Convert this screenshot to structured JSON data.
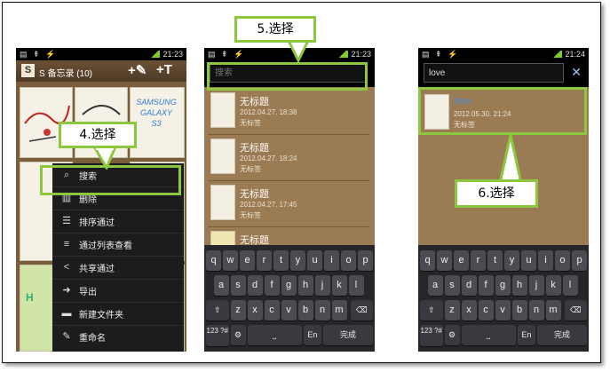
{
  "phone1": {
    "status_time": "21:23",
    "app_title": "S 备忘录 (10)",
    "app_icon": "S",
    "card_text": "SAMSUNG GALAXY S3",
    "menu": [
      {
        "label": "搜索",
        "icon": "search-icon"
      },
      {
        "label": "删除",
        "icon": "delete-icon"
      },
      {
        "label": "排序通过",
        "icon": "sort-icon"
      },
      {
        "label": "通过列表查看",
        "icon": "list-view-icon"
      },
      {
        "label": "共享通过",
        "icon": "share-icon"
      },
      {
        "label": "导出",
        "icon": "export-icon"
      },
      {
        "label": "新建文件夹",
        "icon": "new-folder-icon"
      },
      {
        "label": "重命名",
        "icon": "rename-icon"
      }
    ]
  },
  "phone2": {
    "status_time": "21:23",
    "search_placeholder": "搜索",
    "notes": [
      {
        "title": "无标题",
        "date": "2012.04.27. 18:38",
        "sub": "无标签"
      },
      {
        "title": "无标题",
        "date": "2012.04.27. 18:24",
        "sub": "无标签"
      },
      {
        "title": "无标题",
        "date": "2012.04.27. 17:45",
        "sub": "无标签"
      },
      {
        "title": "无标题"
      }
    ]
  },
  "phone3": {
    "status_time": "21:24",
    "search_value": "love",
    "result": {
      "title": "love",
      "date": "2012.05.30. 21:24",
      "sub": "无标签"
    }
  },
  "callouts": {
    "step4": "4.选择",
    "step5": "5.选择",
    "step6": "6.选择"
  },
  "keyboard": {
    "row1": [
      "q",
      "w",
      "e",
      "r",
      "t",
      "y",
      "u",
      "i",
      "o",
      "p"
    ],
    "row2": [
      "a",
      "s",
      "d",
      "f",
      "g",
      "h",
      "j",
      "k",
      "l"
    ],
    "row3": [
      "z",
      "x",
      "c",
      "v",
      "b",
      "n",
      "m"
    ],
    "num_key": "123 ?#",
    "lang_key": "En",
    "done_key": "完成",
    "settings_icon": "gear-icon",
    "shift_icon": "shift-icon",
    "backspace_icon": "backspace-icon",
    "space_icon": "space-icon"
  },
  "colors": {
    "highlight": "#8dc63f",
    "kraft": "#9b7b53",
    "accent_text": "#4a90d9"
  }
}
